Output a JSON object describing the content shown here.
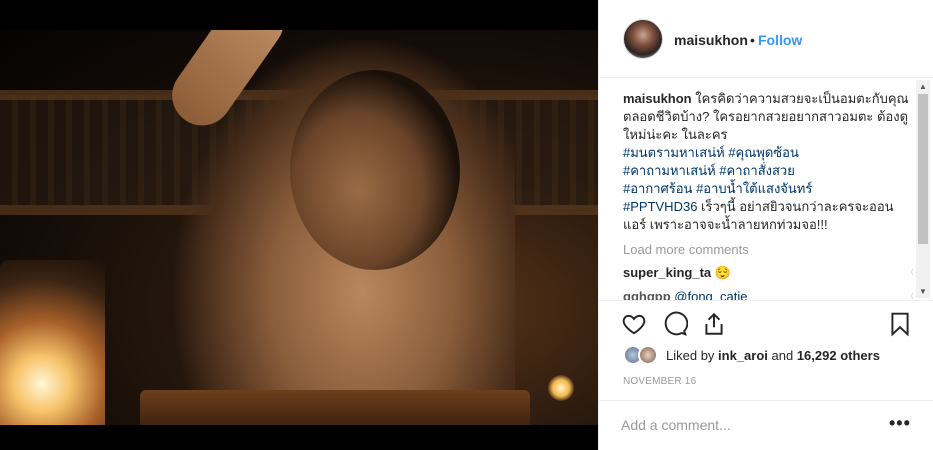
{
  "post": {
    "username": "maisukhon",
    "follow_label": "Follow",
    "separator": "•",
    "caption_text": " ใครคิดว่าความสวยจะเป็นอมตะกับคุณตลอดชีวิตบ้าง? ใครอยากสวยอยากสาวอมตะ ต้องดูใหม่น่ะคะ ในละคร ",
    "hashtags": [
      "#มนตรามหาเสน่ห์",
      "#คุณพุดซ้อน",
      "#คาถามหาเสน่ห์",
      "#คาถาสั่งสวย",
      "#อากาศร้อน",
      "#อาบน้ำใต้แสงจันทร์",
      "#PPTVHD36"
    ],
    "caption_tail": " เร็วๆนี้ อย่าสยิวจนกว่าละครจะออนแอร์ เพราะอาจจะน้ำลายหกท่วมจอ!!!",
    "load_more": "Load more comments",
    "comments": [
      {
        "user": "super_king_ta",
        "text": "😌"
      },
      {
        "user": "gghgpp",
        "text": "@fong_catie"
      }
    ],
    "likes_prefix": "Liked by ",
    "likes_user": "ink_aroi",
    "likes_mid": " and ",
    "likes_count": "16,292 others",
    "date": "November 16",
    "add_comment_placeholder": "Add a comment...",
    "more_label": "•••"
  },
  "icons": {
    "heart": "heart-icon",
    "comment": "comment-icon",
    "share": "share-icon",
    "bookmark": "bookmark-icon"
  }
}
